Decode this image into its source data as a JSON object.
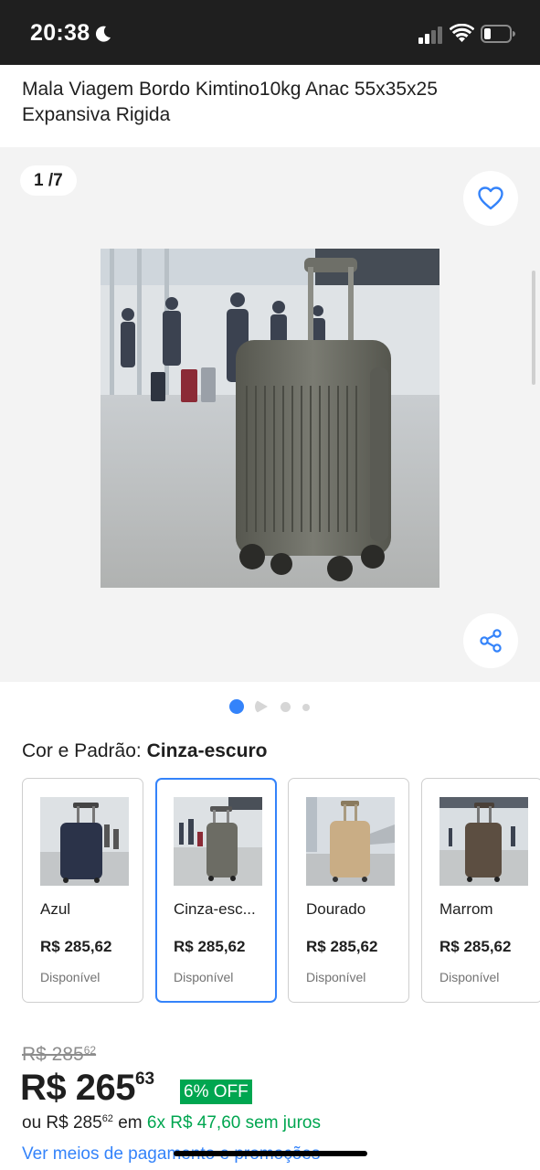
{
  "status_bar": {
    "time": "20:38",
    "icons": [
      "moon-icon",
      "signal-icon",
      "wifi-icon",
      "battery-icon"
    ]
  },
  "product": {
    "title": "Mala Viagem Bordo Kimtino10kg Anac 55x35x25 Expansiva Rigida"
  },
  "gallery": {
    "counter": "1 /7",
    "icons": [
      "heart-icon",
      "share-icon"
    ],
    "current_index": 1,
    "total_images": 7
  },
  "color_selector": {
    "label": "Cor e Padrão: ",
    "selected": "Cinza-escuro",
    "variants": [
      {
        "name": "Azul",
        "price": "R$ 285,62",
        "status": "Disponível",
        "color": "#2b3349"
      },
      {
        "name": "Cinza-esc...",
        "price": "R$ 285,62",
        "status": "Disponível",
        "color": "#6c6c64"
      },
      {
        "name": "Dourado",
        "price": "R$ 285,62",
        "status": "Disponível",
        "color": "#c9ad85"
      },
      {
        "name": "Marrom",
        "price": "R$ 285,62",
        "status": "Disponível",
        "color": "#5c4e41"
      }
    ]
  },
  "pricing": {
    "old_price": "R$ 285",
    "old_price_cents": "62",
    "price": "R$ 265",
    "price_cents": "63",
    "discount": "6% OFF",
    "installments_prefix": "ou R$ 285",
    "installments_cents": "62",
    "installments_mid": " em ",
    "installments_highlight": "6x R$ 47,60 sem juros",
    "payment_link": "Ver meios de pagamento e promoções"
  },
  "colors": {
    "accent": "#3483fa",
    "green": "#00a650",
    "text": "#1f1f1f",
    "muted": "#737373",
    "status_bar": "#1f1f1f"
  }
}
